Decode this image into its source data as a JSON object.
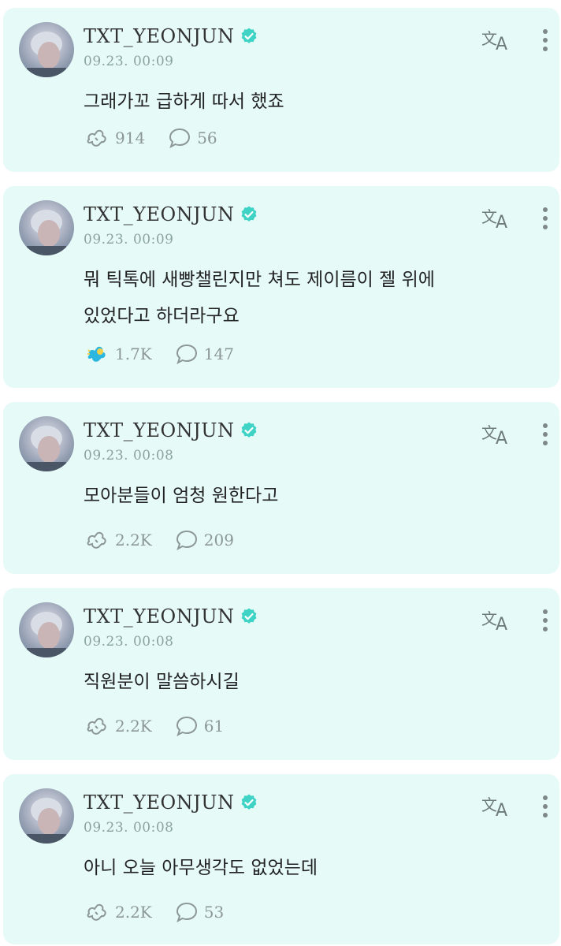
{
  "posts": [
    {
      "username": "TXT_YEONJUN",
      "timestamp": "09.23. 00:09",
      "text": "그래가꼬 급하게 따서 했죠",
      "likes": "914",
      "comments": "56",
      "liked": false
    },
    {
      "username": "TXT_YEONJUN",
      "timestamp": "09.23. 00:09",
      "text": "뭐 틱톡에 새빵챌린지만 쳐도 제이름이 젤 위에\n있었다고 하더라구요",
      "likes": "1.7K",
      "comments": "147",
      "liked": true
    },
    {
      "username": "TXT_YEONJUN",
      "timestamp": "09.23. 00:08",
      "text": "모아분들이 엄청 원한다고",
      "likes": "2.2K",
      "comments": "209",
      "liked": false
    },
    {
      "username": "TXT_YEONJUN",
      "timestamp": "09.23. 00:08",
      "text": "직원분이 말씀하시길",
      "likes": "2.2K",
      "comments": "61",
      "liked": false
    },
    {
      "username": "TXT_YEONJUN",
      "timestamp": "09.23. 00:08",
      "text": "아니 오늘 아무생각도 없었는데",
      "likes": "2.2K",
      "comments": "53",
      "liked": false
    }
  ],
  "colors": {
    "card_background": "#e6fbf8",
    "verified": "#3fd3c6",
    "accent_like": "#2bb7e0"
  },
  "icons": [
    "verified-icon",
    "translate-icon",
    "more-icon",
    "like-icon",
    "comment-icon"
  ]
}
